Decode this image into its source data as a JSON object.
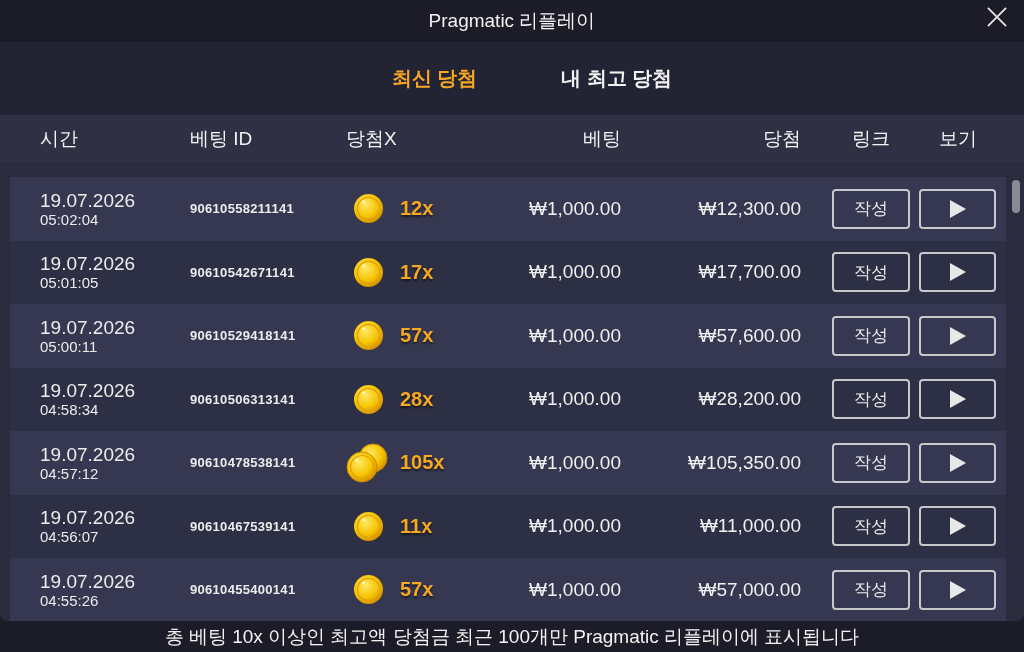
{
  "window": {
    "title": "Pragmatic 리플레이"
  },
  "tabs": [
    {
      "label": "최신 당첨",
      "selected": true
    },
    {
      "label": "내 최고 당첨",
      "selected": false
    }
  ],
  "table": {
    "columns": [
      "시간",
      "베팅 ID",
      "당첨X",
      "베팅",
      "당첨",
      "링크",
      "보기"
    ],
    "rows": [
      {
        "date": "19.07.2026",
        "time": "05:02:04",
        "bet_id": "90610558211141",
        "kind": "single",
        "multiplier": "12x",
        "bet": "₩1,000.00",
        "win": "₩12,300.00",
        "link_button": "작성"
      },
      {
        "date": "19.07.2026",
        "time": "05:01:05",
        "bet_id": "90610542671141",
        "kind": "single",
        "multiplier": "17x",
        "bet": "₩1,000.00",
        "win": "₩17,700.00",
        "link_button": "작성"
      },
      {
        "date": "19.07.2026",
        "time": "05:00:11",
        "bet_id": "90610529418141",
        "kind": "single",
        "multiplier": "57x",
        "bet": "₩1,000.00",
        "win": "₩57,600.00",
        "link_button": "작성"
      },
      {
        "date": "19.07.2026",
        "time": "04:58:34",
        "bet_id": "90610506313141",
        "kind": "single",
        "multiplier": "28x",
        "bet": "₩1,000.00",
        "win": "₩28,200.00",
        "link_button": "작성"
      },
      {
        "date": "19.07.2026",
        "time": "04:57:12",
        "bet_id": "90610478538141",
        "kind": "double",
        "multiplier": "105x",
        "bet": "₩1,000.00",
        "win": "₩105,350.00",
        "link_button": "작성"
      },
      {
        "date": "19.07.2026",
        "time": "04:56:07",
        "bet_id": "90610467539141",
        "kind": "single",
        "multiplier": "11x",
        "bet": "₩1,000.00",
        "win": "₩11,000.00",
        "link_button": "작성"
      },
      {
        "date": "19.07.2026",
        "time": "04:55:26",
        "bet_id": "90610455400141",
        "kind": "single",
        "multiplier": "57x",
        "bet": "₩1,000.00",
        "win": "₩57,000.00",
        "link_button": "작성"
      }
    ]
  },
  "footer": {
    "note": "총 베팅 10x 이상인 최고액 당첨금 최근 100개만 Pragmatic 리플레이에 표시됩니다"
  }
}
